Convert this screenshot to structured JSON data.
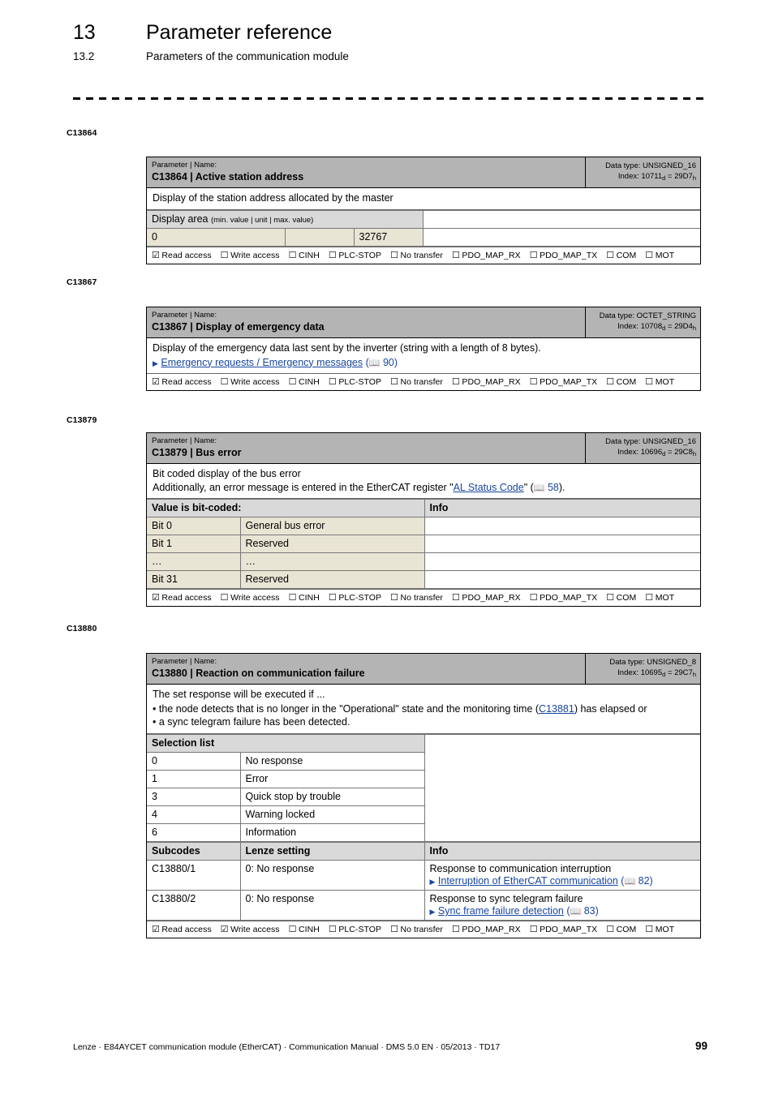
{
  "header": {
    "chapter_number": "13",
    "chapter_title": "Parameter reference",
    "section_number": "13.2",
    "section_title": "Parameters of the communication module"
  },
  "access_labels": [
    "Read access",
    "Write access",
    "CINH",
    "PLC-STOP",
    "No transfer",
    "PDO_MAP_RX",
    "PDO_MAP_TX",
    "COM",
    "MOT"
  ],
  "params": [
    {
      "margin_label": "C13864",
      "kind_label": "Parameter | Name:",
      "title": "C13864 | Active station address",
      "data_type": "Data type: UNSIGNED_16",
      "index_prefix": "Index: 10711",
      "index_sub1": "d",
      "index_mid": " = 29D7",
      "index_sub2": "h",
      "description": "Display of the station address allocated by the master",
      "display_area": {
        "header_bold": "Display area",
        "header_small": "(min. value | unit | max. value)",
        "min": "0",
        "unit": "",
        "max": "32767"
      },
      "access_checked": [
        true,
        false,
        false,
        false,
        false,
        false,
        false,
        false,
        false
      ]
    },
    {
      "margin_label": "C13867",
      "kind_label": "Parameter | Name:",
      "title": "C13867 | Display of emergency data",
      "data_type": "Data type: OCTET_STRING",
      "index_prefix": "Index: 10708",
      "index_sub1": "d",
      "index_mid": " = 29D4",
      "index_sub2": "h",
      "description": "Display of the emergency data last sent by the inverter (string with a length of 8 bytes).",
      "link_line": {
        "text": "Emergency requests / Emergency messages",
        "page": "90"
      },
      "access_checked": [
        true,
        false,
        false,
        false,
        false,
        false,
        false,
        false,
        false
      ]
    },
    {
      "margin_label": "C13879",
      "kind_label": "Parameter | Name:",
      "title": "C13879 | Bus error",
      "data_type": "Data type: UNSIGNED_16",
      "index_prefix": "Index: 10696",
      "index_sub1": "d",
      "index_mid": " = 29C8",
      "index_sub2": "h",
      "desc_line1": "Bit coded display of the bus error",
      "desc_line2_a": "Additionally, an error message is entered in the EtherCAT register \"",
      "desc_link": "AL Status Code",
      "desc_line2_b": "\" (",
      "desc_page": "58",
      "desc_line2_c": ").",
      "bitcoded": {
        "header_left": "Value is bit-coded:",
        "header_right": "Info",
        "rows": [
          {
            "bit": "Bit 0",
            "meaning": "General bus error",
            "info": ""
          },
          {
            "bit": "Bit 1",
            "meaning": "Reserved",
            "info": ""
          },
          {
            "bit": "…",
            "meaning": "…",
            "info": ""
          },
          {
            "bit": "Bit 31",
            "meaning": "Reserved",
            "info": ""
          }
        ]
      },
      "access_checked": [
        true,
        false,
        false,
        false,
        false,
        false,
        false,
        false,
        false
      ]
    },
    {
      "margin_label": "C13880",
      "kind_label": "Parameter | Name:",
      "title": "C13880 | Reaction on communication failure",
      "data_type": "Data type: UNSIGNED_8",
      "index_prefix": "Index: 10695",
      "index_sub1": "d",
      "index_mid": " = 29C7",
      "index_sub2": "h",
      "desc_intro": "The set response will be executed if ...",
      "bullet1_a": "the node detects that is no longer in the \"Operational\" state and the monitoring time (",
      "bullet1_link": "C13881",
      "bullet1_b": ") has elapsed or",
      "bullet2": "a sync telegram failure has been detected.",
      "selection": {
        "header": "Selection list",
        "rows": [
          {
            "value": "0",
            "label": "No response"
          },
          {
            "value": "1",
            "label": "Error"
          },
          {
            "value": "3",
            "label": "Quick stop by trouble"
          },
          {
            "value": "4",
            "label": "Warning locked"
          },
          {
            "value": "6",
            "label": "Information"
          }
        ]
      },
      "subcodes": {
        "headers": [
          "Subcodes",
          "Lenze setting",
          "Info"
        ],
        "rows": [
          {
            "subcode": "C13880/1",
            "setting": "0: No response",
            "info_text": "Response to communication interruption",
            "info_link": "Interruption of EtherCAT communication",
            "info_page": "82"
          },
          {
            "subcode": "C13880/2",
            "setting": "0: No response",
            "info_text": "Response to sync telegram failure",
            "info_link": "Sync frame failure detection",
            "info_page": "83"
          }
        ]
      },
      "access_checked": [
        true,
        true,
        false,
        false,
        false,
        false,
        false,
        false,
        false
      ]
    }
  ],
  "footer": {
    "text": "Lenze · E84AYCET communication module (EtherCAT) · Communication Manual · DMS 5.0 EN · 05/2013 · TD17",
    "page_number": "99"
  },
  "icons": {
    "checked": "☑",
    "unchecked": "☐",
    "book": "📖",
    "triangle": "▶"
  }
}
